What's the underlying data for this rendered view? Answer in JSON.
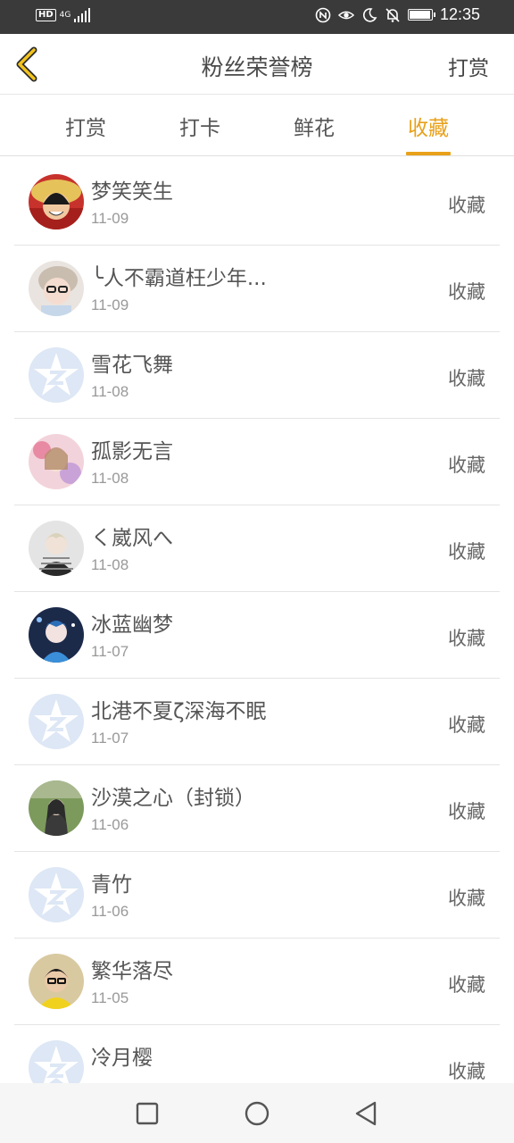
{
  "status_bar": {
    "network_badge": "HD",
    "network_type": "4G",
    "time": "12:35",
    "battery_level": 0.9,
    "icons": [
      "hd-icon",
      "signal-icon",
      "nfc-icon",
      "eye-comfort-icon",
      "do-not-disturb-icon",
      "mute-icon",
      "battery-icon"
    ]
  },
  "header": {
    "title": "粉丝荣誉榜",
    "action": "打赏",
    "back_icon": "chevron-left-icon",
    "accent_color": "#e8a11a"
  },
  "tabs": [
    {
      "label": "打赏",
      "active": false
    },
    {
      "label": "打卡",
      "active": false
    },
    {
      "label": "鲜花",
      "active": false
    },
    {
      "label": "收藏",
      "active": true
    }
  ],
  "fans": [
    {
      "name": "梦笑笑生",
      "date": "11-09",
      "action": "收藏",
      "avatar": "custom-avatar"
    },
    {
      "name": "╰人不霸道枉少年...",
      "date": "11-09",
      "action": "收藏",
      "avatar": "custom-avatar"
    },
    {
      "name": "雪花飞舞",
      "date": "11-08",
      "action": "收藏",
      "avatar": "default-avatar"
    },
    {
      "name": "孤影无言",
      "date": "11-08",
      "action": "收藏",
      "avatar": "custom-avatar"
    },
    {
      "name": "く崴风へ",
      "date": "11-08",
      "action": "收藏",
      "avatar": "custom-avatar"
    },
    {
      "name": "冰蓝幽梦",
      "date": "11-07",
      "action": "收藏",
      "avatar": "custom-avatar"
    },
    {
      "name": "北港不夏ζ深海不眠",
      "date": "11-07",
      "action": "收藏",
      "avatar": "default-avatar"
    },
    {
      "name": "沙漠之心（封锁）",
      "date": "11-06",
      "action": "收藏",
      "avatar": "custom-avatar"
    },
    {
      "name": "青竹",
      "date": "11-06",
      "action": "收藏",
      "avatar": "default-avatar"
    },
    {
      "name": "繁华落尽",
      "date": "11-05",
      "action": "收藏",
      "avatar": "custom-avatar"
    },
    {
      "name": "冷月樱",
      "date": "",
      "action": "收藏",
      "avatar": "default-avatar"
    }
  ],
  "system_nav": [
    "recents-square-icon",
    "home-circle-icon",
    "back-triangle-icon"
  ]
}
